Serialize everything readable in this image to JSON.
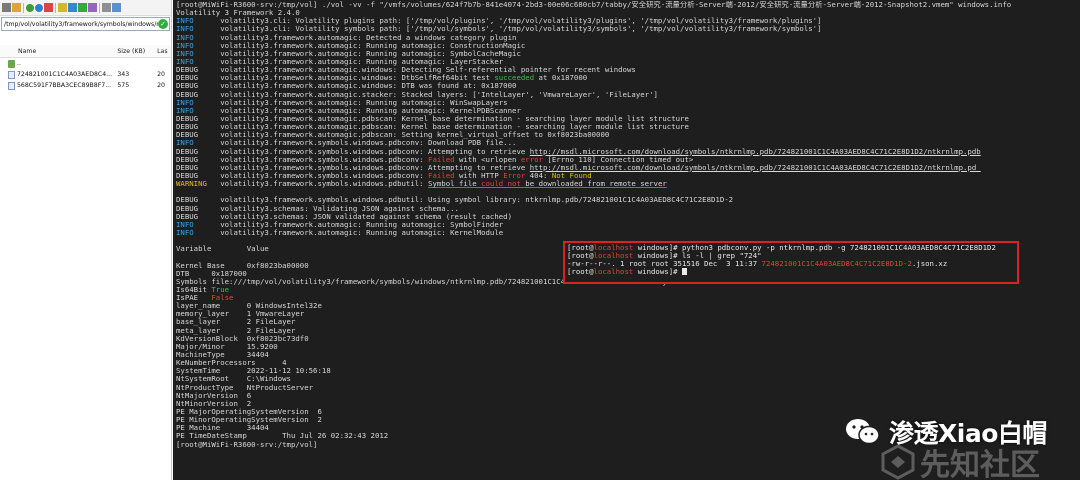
{
  "file_manager": {
    "path": "/tmp/vol/volatility3/framework/symbols/windows/ntkrnlmp.pdb/",
    "columns": {
      "name": "Name",
      "size": "Size (KB)",
      "last": "Las"
    },
    "rows": [
      {
        "name": "..",
        "size": "",
        "last": ""
      },
      {
        "name": "724821001C1C4A03AED8C4...",
        "size": "343",
        "last": "20"
      },
      {
        "name": "568C591F7BBA3CEC89B8F7...",
        "size": "575",
        "last": "20"
      }
    ]
  },
  "terminal": {
    "command": {
      "prompt": "[root@MiWiFi-R3600-srv:/tmp/vol]",
      "text": " ./vol -vv -f \"/vmfs/volumes/624f7b7b-841e4074-2bd3-00e06c680cb7/tabby/安全研究-流量分析-Server端-2012/安全研究-流量分析-Server端-2012-Snapshot2.vmem\" windows.info"
    },
    "banner": "Volatility 3 Framework 2.4.0",
    "logs": [
      {
        "level": "INFO",
        "msg": "volatility3.cli: Volatility plugins path: ['/tmp/vol/plugins', '/tmp/vol/volatility3/plugins', '/tmp/vol/volatility3/framework/plugins']"
      },
      {
        "level": "INFO",
        "msg": "volatility3.cli: Volatility symbols path: ['/tmp/vol/symbols', '/tmp/vol/volatility3/symbols', '/tmp/vol/volatility3/framework/symbols']"
      },
      {
        "level": "INFO",
        "msg": "volatility3.framework.automagic: Detected a windows category plugin"
      },
      {
        "level": "INFO",
        "msg": "volatility3.framework.automagic: Running automagic: ConstructionMagic"
      },
      {
        "level": "INFO",
        "msg": "volatility3.framework.automagic: Running automagic: SymbolCacheMagic"
      },
      {
        "level": "INFO",
        "msg": "volatility3.framework.automagic: Running automagic: LayerStacker"
      },
      {
        "level": "DEBUG",
        "msg": "volatility3.framework.automagic.windows: Detecting Self-referential pointer for recent windows"
      },
      {
        "level": "DEBUG",
        "msg": "volatility3.framework.automagic.windows: DtbSelfRef64bit test ",
        "hl": "succeeded",
        "msg2": " at 0x187000"
      },
      {
        "level": "DEBUG",
        "msg": "volatility3.framework.automagic.windows: DTB was found at: 0x187000"
      },
      {
        "level": "DEBUG",
        "msg": "volatility3.framework.automagic.stacker: Stacked layers: ['IntelLayer', 'VmwareLayer', 'FileLayer']"
      },
      {
        "level": "INFO",
        "msg": "volatility3.framework.automagic: Running automagic: WinSwapLayers"
      },
      {
        "level": "INFO",
        "msg": "volatility3.framework.automagic: Running automagic: KernelPDBScanner"
      },
      {
        "level": "DEBUG",
        "msg": "volatility3.framework.automagic.pdbscan: Kernel base determination - searching layer module list structure"
      },
      {
        "level": "DEBUG",
        "msg": "volatility3.framework.automagic.pdbscan: Kernel base determination - searching layer module list structure"
      },
      {
        "level": "DEBUG",
        "msg": "volatility3.framework.automagic.pdbscan: Setting kernel_virtual_offset to 0xf8023ba00000"
      },
      {
        "level": "INFO",
        "msg": "volatility3.framework.symbols.windows.pdbconv: Download PDB file..."
      },
      {
        "level": "DEBUG",
        "msg": "volatility3.framework.symbols.windows.pdbconv: Attempting to retrieve ",
        "url": "http://msdl.microsoft.com/download/symbols/ntkrnlmp.pdb/724821001C1C4A03AED8C4C71C2E8D1D2/ntkrnlmp.pdb"
      },
      {
        "level": "DEBUG",
        "msg": "volatility3.framework.symbols.windows.pdbconv: ",
        "red": "Failed",
        "msg2": " with <urlopen ",
        "red2": "error",
        "msg3": " [Errno 110] Connection timed out>"
      },
      {
        "level": "DEBUG",
        "msg": "volatility3.framework.symbols.windows.pdbconv: Attempting to retrieve ",
        "url": "http://msdl.microsoft.com/download/symbols/ntkrnlmp.pdb/724821001C1C4A03AED8C4C71C2E8D1D2/ntkrnlmp.pd_"
      },
      {
        "level": "DEBUG",
        "msg": "volatility3.framework.symbols.windows.pdbconv: ",
        "red": "Failed",
        "msg2": " with HTTP ",
        "red2": "Error",
        "msg3": " 404: ",
        "yel": "Not Found"
      },
      {
        "level": "WARNING",
        "msg": "volatility3.framework.symbols.windows.pdbutil: ",
        "u1": "Symbol file ",
        "ured": "could not",
        "u2": " be downloaded from remote server"
      },
      {
        "level": "",
        "msg": ""
      },
      {
        "level": "DEBUG",
        "msg": "volatility3.framework.symbols.windows.pdbutil: Using symbol library: ntkrnlmp.pdb/724821001C1C4A03AED8C4C71C2E8D1D-2"
      },
      {
        "level": "DEBUG",
        "msg": "volatility3.schemas: Validating JSON against schema..."
      },
      {
        "level": "DEBUG",
        "msg": "volatility3.schemas: JSON validated against schema (result cached)"
      },
      {
        "level": "INFO",
        "msg": "volatility3.framework.automagic: Running automagic: SymbolFinder"
      },
      {
        "level": "INFO",
        "msg": "volatility3.framework.automagic: Running automagic: KernelModule"
      }
    ],
    "table": {
      "header": "Variable        Value",
      "rows": [
        {
          "t": ""
        },
        {
          "t": "Kernel Base     0xf8023ba00000"
        },
        {
          "t": "DTB     0x187000"
        },
        {
          "t": "Symbols file:///tmp/vol/volatility3/framework/symbols/windows/ntkrnlmp.pdb/724821001C1C4A03AED8C4C71C2E8D1D-2.json.xz"
        },
        {
          "t": "Is64Bit ",
          "hl": "True",
          "color": "green"
        },
        {
          "t": "IsPAE   ",
          "hl": "False",
          "color": "red"
        },
        {
          "t": "layer_name      0 WindowsIntel32e"
        },
        {
          "t": "memory_layer    1 VmwareLayer"
        },
        {
          "t": "base_layer      2 FileLayer"
        },
        {
          "t": "meta_layer      2 FileLayer"
        },
        {
          "t": "KdVersionBlock  0xf8023bc73df0"
        },
        {
          "t": "Major/Minor     15.9200"
        },
        {
          "t": "MachineType     34404"
        },
        {
          "t": "KeNumberProcessors      4"
        },
        {
          "t": "SystemTime      2022-11-12 10:56:18"
        },
        {
          "t": "NtSystemRoot    C:\\Windows"
        },
        {
          "t": "NtProductType   NtProductServer"
        },
        {
          "t": "NtMajorVersion  6"
        },
        {
          "t": "NtMinorVersion  2"
        },
        {
          "t": "PE MajorOperatingSystemVersion  6"
        },
        {
          "t": "PE MinorOperatingSystemVersion  2"
        },
        {
          "t": "PE Machine      34404"
        },
        {
          "t": "PE TimeDateStamp        Thu Jul 26 02:32:43 2012"
        }
      ]
    },
    "final_prompt": "[root@MiWiFi-R3600-srv:/tmp/vol]"
  },
  "highlight_box": {
    "lines": [
      {
        "pre": "[root@",
        "host": "localhost",
        "post": " windows]# python3 pdbconv.py -p ntkrnlmp.pdb -g 724821001C1C4A03AED8C4C71C2E8D1D2"
      },
      {
        "pre": "[root@",
        "host": "localhost",
        "post": " windows]# ls -l | grep \"724\""
      },
      {
        "pre": "-rw-r--r--. 1 root root 351516 Dec  3 11:37 ",
        "file": "724821001C1C4A03AED8C4C71C2E8D1D-2",
        "post": ".json.xz"
      },
      {
        "pre": "[root@",
        "host": "localhost",
        "post": " windows]# "
      }
    ]
  },
  "watermark": {
    "text": "渗透Xiao白帽",
    "icon": "wechat-icon",
    "site_text": "先知社区",
    "site_icon": "xianzhi-logo-icon"
  },
  "colors": {
    "terminal_bg": "#1e1e1e",
    "info": "#3aa6e8",
    "warning": "#e6c200",
    "error": "#e0453a",
    "success": "#3cc04a",
    "box_border": "#e02020"
  }
}
